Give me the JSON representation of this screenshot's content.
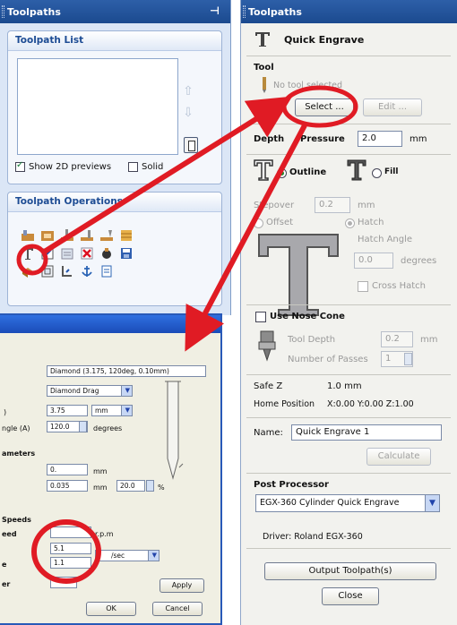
{
  "left_panel": {
    "title": "Toolpaths",
    "pin_glyph": "⊣",
    "toolpath_list": {
      "title": "Toolpath List",
      "show_2d_previews": "Show 2D previews",
      "solid": "Solid"
    },
    "toolpath_operations": {
      "title": "Toolpath Operations",
      "icons": [
        "profile-toolpath-icon",
        "pocket-toolpath-icon",
        "drill-toolpath-icon",
        "inlay-toolpath-icon",
        "vcarve-toolpath-icon",
        "texture-toolpath-icon",
        "quick-engrave-icon",
        "fluting-toolpath-icon",
        "prism-toolpath-icon",
        "delete-toolpath-icon",
        "lamp-toolpath-icon",
        "save-toolpath-icon",
        "material-setup-icon",
        "fit-view-icon",
        "moulding-toolpath-icon",
        "anchor-toolpath-icon",
        "toolpath-template-icon"
      ]
    }
  },
  "tool_dialog": {
    "tool_name": "Diamond (3.175, 120deg, 0.10mm)",
    "tool_type": "Diamond Drag",
    "dim_value": "3.75",
    "dim_unit": "mm",
    "angle_label": "ngle (A)",
    "angle_value": "120.0",
    "angle_unit": "degrees",
    "params_label": "ameters",
    "stepdown": "0.",
    "stepdown_unit": "mm",
    "stepover": "0.035",
    "stepover_unit": "mm",
    "stepover_pct": "20.0",
    "pct_sign": "%",
    "speeds_label": "Speeds",
    "spindle_label": "eed",
    "rpm_unit": "r.p.m",
    "feed_label": "",
    "feed_value": "5.1",
    "plunge_label": "e",
    "plunge_value": "1.1",
    "rate_unit": "/sec",
    "tool_number_label": "er",
    "apply": "Apply",
    "ok": "OK",
    "cancel": "Cancel",
    "small_label_1": ")",
    "small_label_2": "u"
  },
  "right_panel": {
    "title": "Toolpaths",
    "heading": "Quick Engrave",
    "tool_section": "Tool",
    "no_tool_selected": "No tool selected",
    "select_button": "Select ...",
    "edit_button": "Edit ...",
    "depth_label": "Depth",
    "pressure_label": "Pressure",
    "depth_value": "2.0",
    "depth_unit": "mm",
    "outline_label": "Outline",
    "fill_label": "Fill",
    "stepover_label": "Stepover",
    "stepover_value": "0.2",
    "stepover_unit": "mm",
    "offset_label": "Offset",
    "hatch_label": "Hatch",
    "hatch_angle_label": "Hatch Angle",
    "hatch_angle_value": "0.0",
    "hatch_angle_unit": "degrees",
    "cross_hatch_label": "Cross Hatch",
    "use_nose_cone": "Use Nose Cone",
    "tool_depth_label": "Tool Depth",
    "tool_depth_value": "0.2",
    "tool_depth_unit": "mm",
    "passes_label": "Number of Passes",
    "passes_value": "1",
    "safe_z_label": "Safe Z",
    "safe_z_value": "1.0 mm",
    "home_position_label": "Home Position",
    "home_position_value": "X:0.00 Y:0.00 Z:1.00",
    "name_label": "Name:",
    "name_value": "Quick Engrave 1",
    "calculate_button": "Calculate",
    "post_processor_label": "Post Processor",
    "post_processor_value": "EGX-360 Cylinder Quick Engrave",
    "driver_text": "Driver: Roland EGX-360",
    "output_button": "Output Toolpath(s)",
    "close_button": "Close"
  },
  "annotation_color": "#e01b24"
}
